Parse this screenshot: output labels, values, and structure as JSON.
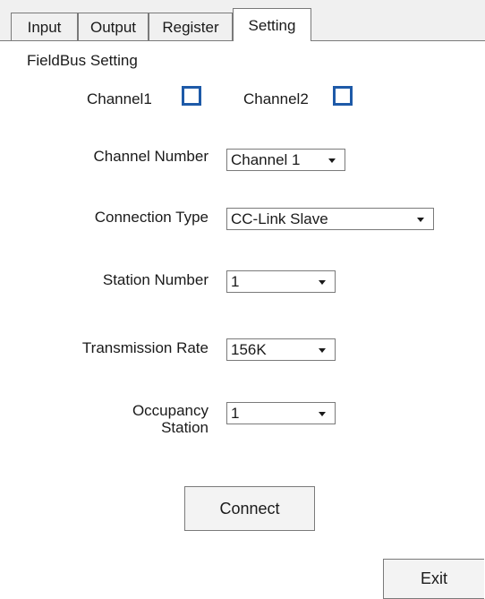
{
  "tabs": [
    {
      "label": "Input"
    },
    {
      "label": "Output"
    },
    {
      "label": "Register"
    },
    {
      "label": "Setting",
      "active": true
    }
  ],
  "fieldbus": {
    "group_label": "FieldBus Setting",
    "channel1_label": "Channel1",
    "channel1_checked": false,
    "channel2_label": "Channel2",
    "channel2_checked": false
  },
  "form": {
    "channel_number": {
      "label": "Channel Number",
      "value": "Channel 1"
    },
    "connection_type": {
      "label": "Connection Type",
      "value": "CC-Link Slave"
    },
    "station_number": {
      "label": "Station Number",
      "value": "1"
    },
    "transmission_rate": {
      "label": "Transmission Rate",
      "value": "156K"
    },
    "occupancy_station": {
      "label_line1": "Occupancy",
      "label_line2": "Station",
      "value": "1"
    }
  },
  "buttons": {
    "connect": "Connect",
    "exit": "Exit"
  },
  "colors": {
    "checkbox_border": "#1e5aa8",
    "panel_background": "#ffffff",
    "window_background": "#f0f0f0"
  },
  "icons": {
    "dropdown": "chevron-down-icon"
  }
}
